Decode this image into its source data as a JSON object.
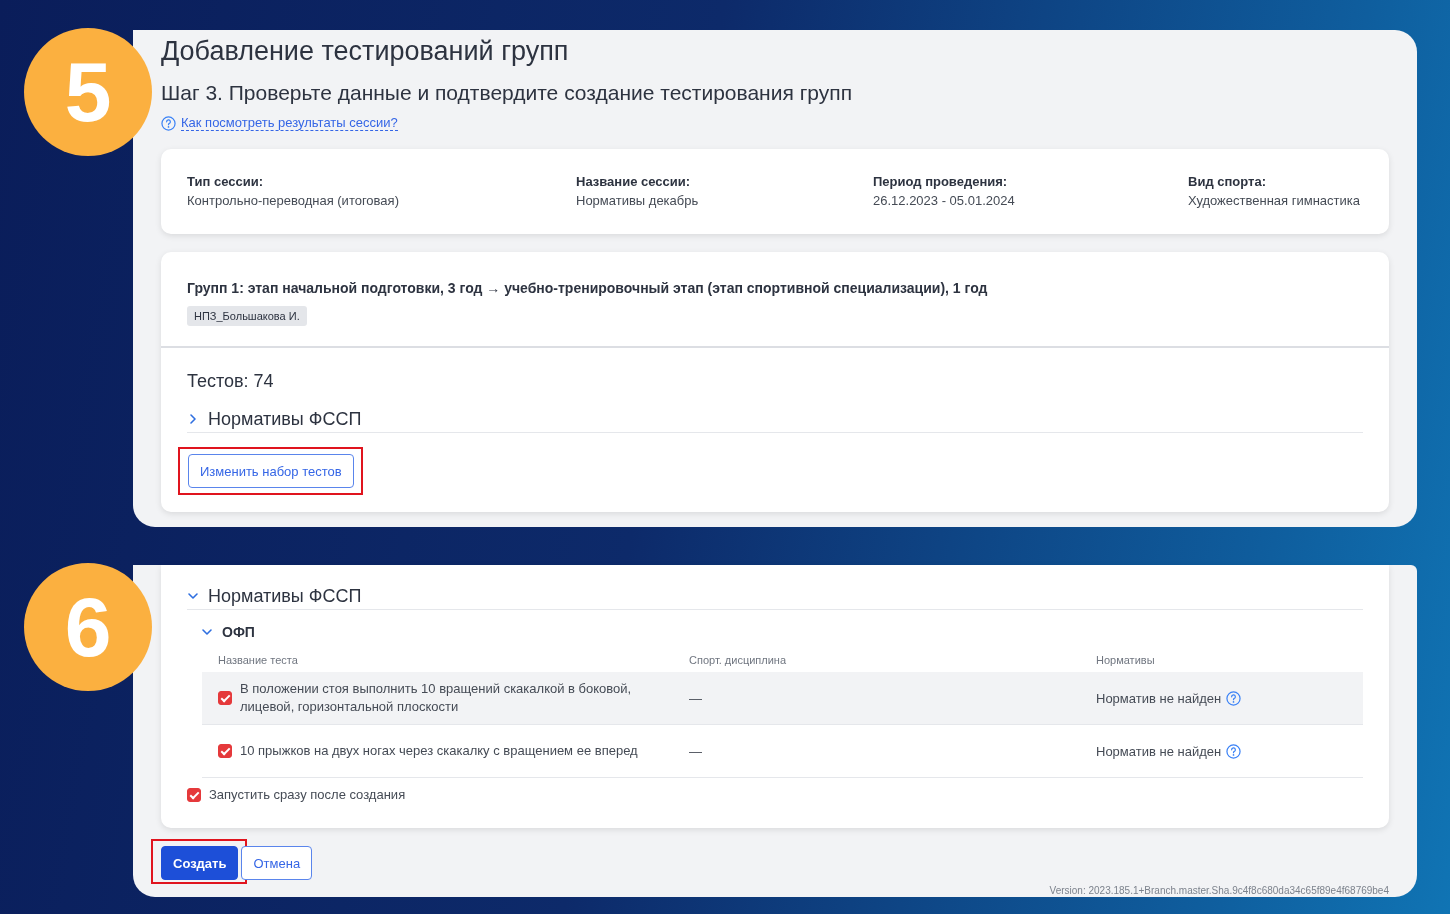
{
  "panels": [
    {
      "kind": "review",
      "step": "5",
      "title": "Добавление тестирований групп",
      "subtitle": "Шаг 3. Проверьте данные и подтвердите создание тестирования групп",
      "help_link": "Как посмотреть результаты сессии?",
      "session_info": [
        {
          "label": "Тип сессии:",
          "value": "Контрольно-переводная (итоговая)"
        },
        {
          "label": "Название сессии:",
          "value": "Нормативы декабрь"
        },
        {
          "label": "Период проведения:",
          "value": "26.12.2023 - 05.01.2024"
        },
        {
          "label": "Вид спорта:",
          "value": "Художественная гимнастика"
        }
      ],
      "group": {
        "title": "Групп 1: этап начальной подготовки, 3 год → учебно-тренировочный этап (этап спортивной специализации), 1 год",
        "tag": "НПЗ_Большакова И."
      },
      "tests_count": "Тестов: 74",
      "section": {
        "title": "Нормативы ФССП",
        "expanded": false
      },
      "change_button": {
        "label": "Изменить набор тестов",
        "highlighted": true
      }
    },
    {
      "kind": "tests",
      "step": "6",
      "section": {
        "title": "Нормативы ФССП",
        "expanded": true,
        "subsection": {
          "title": "ОФП",
          "expanded": true,
          "columns": [
            "Название теста",
            "Спорт. дисциплина",
            "Нормативы"
          ],
          "rows": [
            {
              "checked": true,
              "hovered": true,
              "name": "В положении стоя выполнить 10 вращений скакалкой в боковой, лицевой, горизонтальной плоскости",
              "discipline": "—",
              "norm": "Норматив не найден"
            },
            {
              "checked": true,
              "hovered": false,
              "name": "10 прыжков на двух ногах через скакалку с вращением ее вперед",
              "discipline": "—",
              "norm": "Норматив не найден"
            }
          ]
        }
      },
      "start_after": {
        "label": "Запустить сразу после создания",
        "checked": true
      },
      "buttons": [
        {
          "label": "Создать",
          "kind": "primary",
          "highlighted": true
        },
        {
          "label": "Отмена",
          "kind": "secondary",
          "highlighted": false
        }
      ],
      "version": "Version: 2023.185.1+Branch.master.Sha.9c4f8c680da34c65f89e4f68769be4"
    }
  ]
}
